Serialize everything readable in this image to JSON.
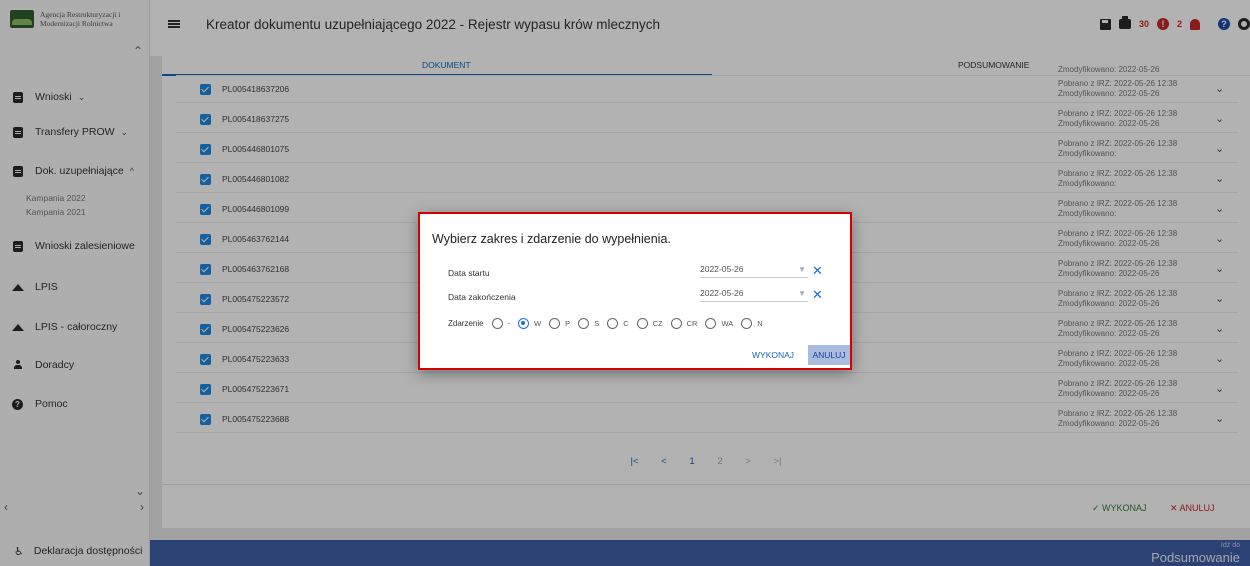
{
  "app": {
    "logo_text": "Agencja Restrukturyzacji i Modernizacji Rolnictwa",
    "title": "Kreator dokumentu uzupełniającego 2022 - Rejestr wypasu krów mlecznych"
  },
  "header": {
    "error_count": "30",
    "error_icon_glyph": "!",
    "warning_count": "2",
    "help_icon_glyph": "?"
  },
  "sidebar": {
    "items": [
      {
        "label": "Wnioski",
        "icon": "document-icon",
        "chevron": "⌄"
      },
      {
        "label": "Transfery PROW",
        "icon": "document-icon",
        "chevron": "⌄"
      },
      {
        "label": "Dok. uzupełniające",
        "icon": "document-icon",
        "chevron": "^"
      },
      {
        "label": "Wnioski zalesieniowe",
        "icon": "document-icon",
        "chevron": ""
      },
      {
        "label": "LPIS",
        "icon": "mountain-icon",
        "chevron": ""
      },
      {
        "label": "LPIS - całoroczny",
        "icon": "mountain-icon",
        "chevron": ""
      },
      {
        "label": "Doradcy",
        "icon": "person-icon",
        "chevron": ""
      },
      {
        "label": "Pomoc",
        "icon": "help-icon",
        "chevron": ""
      }
    ],
    "subitems": [
      "Kampania 2022",
      "Kampania 2021"
    ],
    "footer": "Deklaracja dostępności"
  },
  "tabs": {
    "document": "DOKUMENT",
    "summary": "PODSUMOWANIE"
  },
  "table": {
    "partial_top_status": "Zmodyfikowano: 2022-05-26",
    "rows": [
      {
        "id": "PL005418637206",
        "line1": "Pobrano z IRZ: 2022-05-26 12:38",
        "line2": "Zmodyfikowano: 2022-05-26",
        "checked": true
      },
      {
        "id": "PL005418637275",
        "line1": "Pobrano z IRZ: 2022-05-26 12:38",
        "line2": "Zmodyfikowano: 2022-05-26",
        "checked": true
      },
      {
        "id": "PL005446801075",
        "line1": "Pobrano z IRZ: 2022-05-26 12:38",
        "line2": "Zmodyfikowano:",
        "checked": true
      },
      {
        "id": "PL005446801082",
        "line1": "Pobrano z IRZ: 2022-05-26 12:38",
        "line2": "Zmodyfikowano:",
        "checked": true
      },
      {
        "id": "PL005446801099",
        "line1": "Pobrano z IRZ: 2022-05-26 12:38",
        "line2": "Zmodyfikowano:",
        "checked": true
      },
      {
        "id": "PL005463762144",
        "line1": "Pobrano z IRZ: 2022-05-26 12:38",
        "line2": "Zmodyfikowano: 2022-05-26",
        "checked": true
      },
      {
        "id": "PL005463762168",
        "line1": "Pobrano z IRZ: 2022-05-26 12:38",
        "line2": "Zmodyfikowano: 2022-05-26",
        "checked": true
      },
      {
        "id": "PL005475223572",
        "line1": "Pobrano z IRZ: 2022-05-26 12:38",
        "line2": "Zmodyfikowano: 2022-05-26",
        "checked": true
      },
      {
        "id": "PL005475223626",
        "line1": "Pobrano z IRZ: 2022-05-26 12:38",
        "line2": "Zmodyfikowano: 2022-05-26",
        "checked": true
      },
      {
        "id": "PL005475223633",
        "line1": "Pobrano z IRZ: 2022-05-26 12:38",
        "line2": "Zmodyfikowano: 2022-05-26",
        "checked": true
      },
      {
        "id": "PL005475223671",
        "line1": "Pobrano z IRZ: 2022-05-26 12:38",
        "line2": "Zmodyfikowano: 2022-05-26",
        "checked": true
      },
      {
        "id": "PL005475223688",
        "line1": "Pobrano z IRZ: 2022-05-26 12:38",
        "line2": "Zmodyfikowano: 2022-05-26",
        "checked": true
      }
    ]
  },
  "pagination": {
    "first": "|<",
    "prev": "<",
    "current": "1",
    "next_page": "2",
    "next": ">",
    "last": ">|"
  },
  "actions": {
    "run": "✓ WYKONAJ",
    "cancel": "✕ ANULUJ"
  },
  "bottom_bar": {
    "label": "Idź do",
    "value": "Podsumowanie"
  },
  "dialog": {
    "title": "Wybierz zakres i zdarzenie do wypełnienia.",
    "start_label": "Data startu",
    "start_value": "2022-05-26",
    "end_label": "Data zakończenia",
    "end_value": "2022-05-26",
    "event_label": "Zdarzenie",
    "event_options": [
      "-",
      "W",
      "P",
      "S",
      "C",
      "CZ",
      "CR",
      "WA",
      "N"
    ],
    "event_selected": "W",
    "run_button": "WYKONAJ",
    "cancel_button": "ANULUJ"
  },
  "colors": {
    "accent": "#1565c0",
    "error": "#c62828",
    "dialog_border": "#d50000",
    "bottom_bar": "#3f5fa6"
  }
}
